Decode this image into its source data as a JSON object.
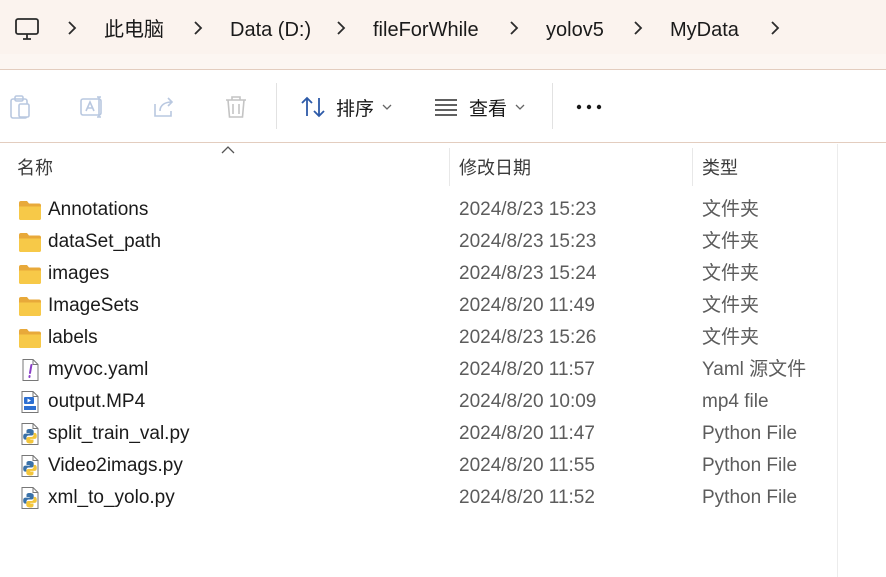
{
  "breadcrumb": {
    "items": [
      "此电脑",
      "Data (D:)",
      "fileForWhile",
      "yolov5",
      "MyData"
    ]
  },
  "toolbar": {
    "sort_label": "排序",
    "view_label": "查看",
    "more_label": "..."
  },
  "columns": {
    "name": "名称",
    "date": "修改日期",
    "type": "类型"
  },
  "files": [
    {
      "name": "Annotations",
      "date": "2024/8/23 15:23",
      "type": "文件夹",
      "icon": "folder-icon"
    },
    {
      "name": "dataSet_path",
      "date": "2024/8/23 15:23",
      "type": "文件夹",
      "icon": "folder-icon"
    },
    {
      "name": "images",
      "date": "2024/8/23 15:24",
      "type": "文件夹",
      "icon": "folder-icon"
    },
    {
      "name": "ImageSets",
      "date": "2024/8/20 11:49",
      "type": "文件夹",
      "icon": "folder-icon"
    },
    {
      "name": "labels",
      "date": "2024/8/23 15:26",
      "type": "文件夹",
      "icon": "folder-icon"
    },
    {
      "name": "myvoc.yaml",
      "date": "2024/8/20 11:57",
      "type": "Yaml 源文件",
      "icon": "yaml-file-icon"
    },
    {
      "name": "output.MP4",
      "date": "2024/8/20 10:09",
      "type": "mp4 file",
      "icon": "video-file-icon"
    },
    {
      "name": "split_train_val.py",
      "date": "2024/8/20 11:47",
      "type": "Python File",
      "icon": "python-file-icon"
    },
    {
      "name": "Video2imags.py",
      "date": "2024/8/20 11:55",
      "type": "Python File",
      "icon": "python-file-icon"
    },
    {
      "name": "xml_to_yolo.py",
      "date": "2024/8/20 11:52",
      "type": "Python File",
      "icon": "python-file-icon"
    }
  ],
  "colors": {
    "address_bg": "#fbf3ee",
    "folder_yellow": "#f7c948",
    "accent_blue": "#2d6fd1"
  }
}
